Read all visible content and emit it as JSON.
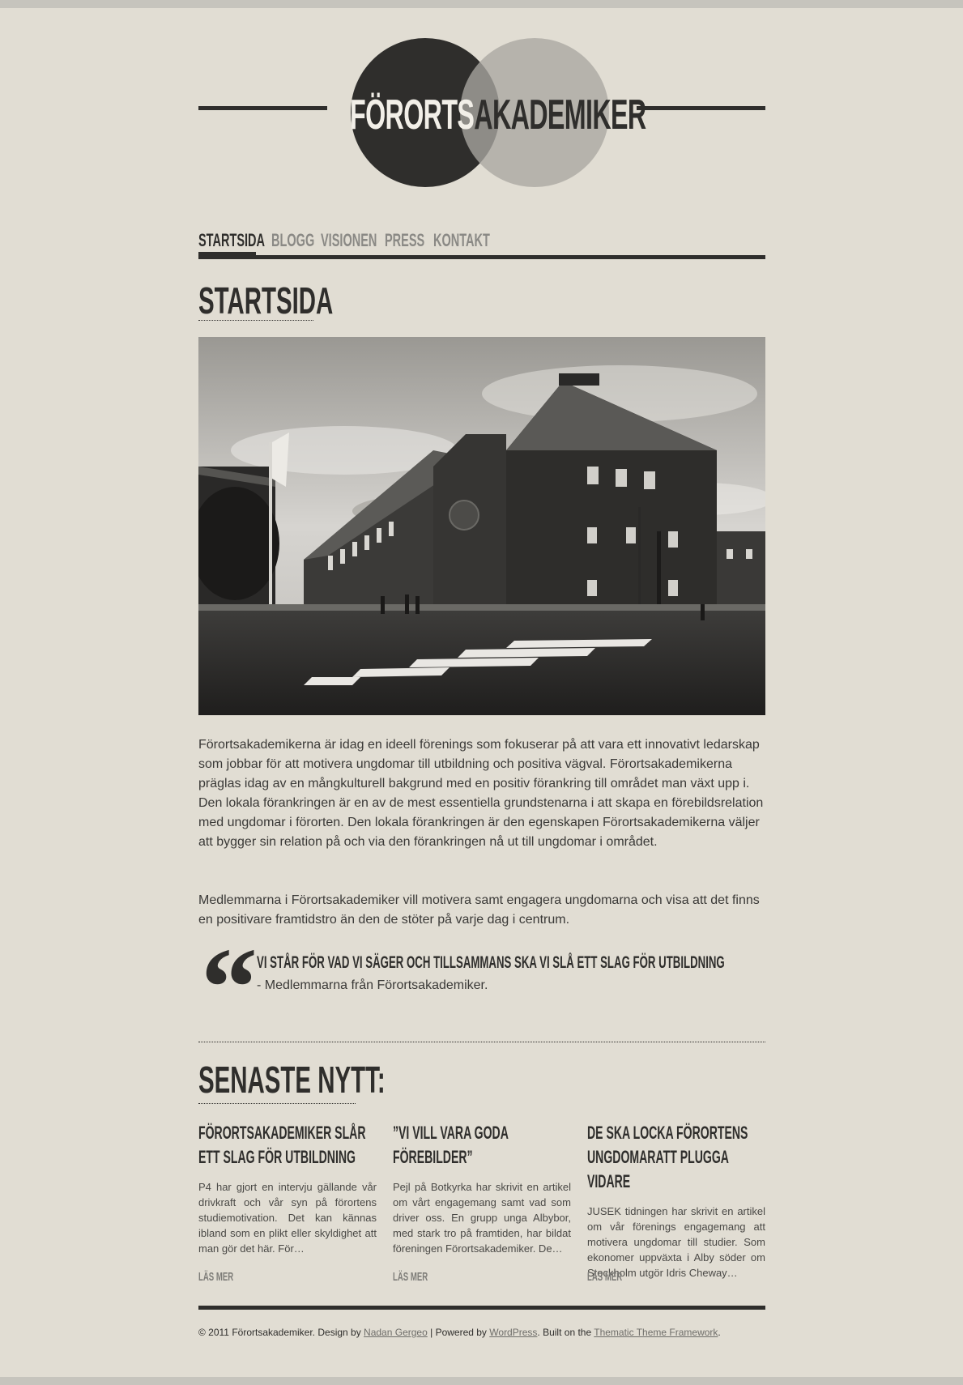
{
  "site": {
    "logo_part1": "FÖRORTS",
    "logo_part2": "AKADEMIKER"
  },
  "nav": {
    "items": [
      {
        "label": "STARTSIDA"
      },
      {
        "label": "BLOGG"
      },
      {
        "label": "VISIONEN"
      },
      {
        "label": "PRESS"
      },
      {
        "label": "KONTAKT"
      }
    ]
  },
  "main": {
    "title": "STARTSIDA",
    "paragraph1": "Förortsakademikerna är idag en ideell förenings som fokuserar på att vara ett innovativt ledarskap som jobbar för att motivera ungdomar till utbildning och positiva vägval. Förortsakademikerna präglas idag av en mångkulturell bakgrund med en positiv förankring till området man växt upp i. Den lokala förankringen är en av de mest essentiella grundstenarna i att skapa en förebildsrelation med ungdomar i förorten. Den lokala förankringen är den egenskapen Förortsakademikerna väljer att bygger sin relation på och via den förankringen nå ut till ungdomar i området.",
    "paragraph2": "Medlemmarna i Förortsakademiker vill motivera samt engagera ungdomarna och visa att det finns en positivare framtidstro än den de stöter på varje dag i centrum.",
    "quote": {
      "text": "VI STÅR FÖR VAD VI SÄGER OCH TILLSAMMANS SKA VI SLÅ ETT SLAG FÖR UTBILDNING",
      "attribution": "- Medlemmarna från Förortsakademiker."
    }
  },
  "news": {
    "title": "SENASTE NYTT:",
    "posts": [
      {
        "title": "FÖRORTSAKADEMIKER SLÅR ETT SLAG FÖR UTBILDNING",
        "excerpt": "P4 har gjort en intervju gällande vår drivkraft och vår syn på förortens studiemotivation. Det kan kännas ibland som en plikt eller skyldighet att man gör det här. För…",
        "read_more": "LÄS MER"
      },
      {
        "title": "”VI VILL VARA GODA FÖREBILDER”",
        "excerpt": "Pejl på Botkyrka har skrivit en artikel om vårt engagemang samt vad som driver oss. En grupp unga Albybor, med stark tro på framtiden, har bildat föreningen Förortsakademiker. De…",
        "read_more": "LÄS MER"
      },
      {
        "title": "DE SKA LOCKA FÖRORTENS UNGDOMARATT PLUGGA VIDARE",
        "excerpt": "JUSEK tidningen har skrivit en artikel om vår förenings engagemang att motivera ungdomar till studier. Som ekonomer uppväxta i Alby söder om Stockholm utgör Idris Cheway…",
        "read_more": "LÄS MER"
      }
    ]
  },
  "footer": {
    "copyright": "© 2011 Förortsakademiker. Design by ",
    "designer_link": "Nadan Gergeo",
    "sep1": " | Powered by ",
    "wordpress_link": "WordPress",
    "sep2": ". Built on the ",
    "theme_link": "Thematic Theme Framework",
    "end": "."
  },
  "colors": {
    "background": "#e1ddd3",
    "ink": "#2f2e2c",
    "muted": "#8a8985"
  }
}
